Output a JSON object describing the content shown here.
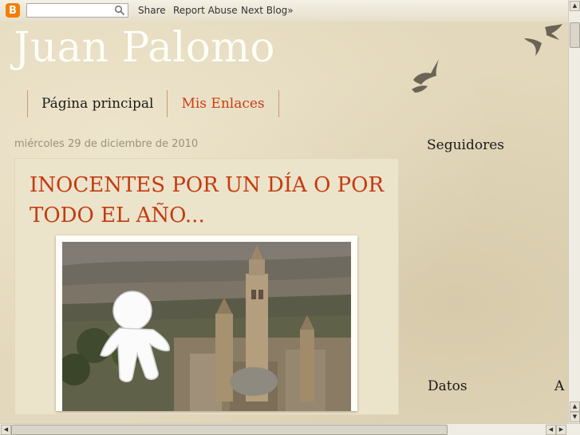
{
  "navbar": {
    "logo_letter": "B",
    "search": {
      "value": "",
      "placeholder": ""
    },
    "share_label": "Share",
    "report_label": "Report Abuse",
    "next_label": "Next Blog»"
  },
  "blog": {
    "title": "Juan Palomo"
  },
  "tabs": [
    {
      "label": "Página principal"
    },
    {
      "label": "Mis Enlaces"
    }
  ],
  "post": {
    "date": "miércoles 29 de diciembre de 2010",
    "title": "INOCENTES POR UN DÍA O POR TODO EL AÑO..."
  },
  "sidebar": {
    "followers_heading": "Seguidores",
    "datos_heading": "Datos",
    "partial_heading": "A"
  },
  "colors": {
    "title_red": "#c33b10",
    "tab_link_red": "#cc3d10",
    "paper": "#e3d8bb"
  },
  "icons": [
    "blogger-logo-icon",
    "search-icon",
    "bird-icon"
  ]
}
